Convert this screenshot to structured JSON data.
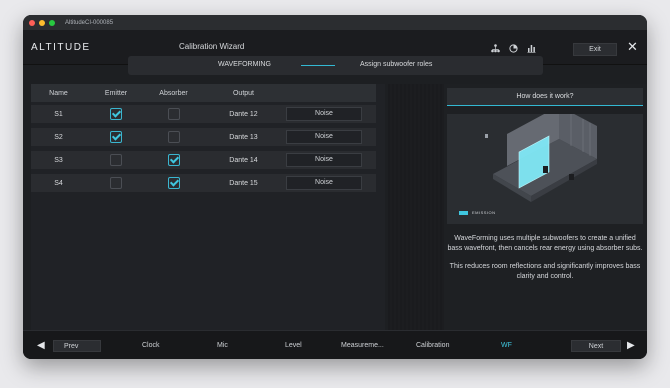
{
  "window": {
    "title": "AltitudeCI-000085",
    "traffic_colors": [
      "#fd5f57",
      "#febc2e",
      "#28c840"
    ]
  },
  "appbar": {
    "brand": "ALTITUDE",
    "title": "Calibration Wizard",
    "icons": [
      "network-icon",
      "pie-icon",
      "bar-chart-icon"
    ],
    "exit_label": "Exit",
    "close_icon": "close-icon"
  },
  "steps": {
    "left": "WAVEFORMING",
    "right": "Assign subwoofer roles",
    "accent": "#33b9d3"
  },
  "table": {
    "headers": [
      "Name",
      "Emitter",
      "Absorber",
      "Output"
    ],
    "rows": [
      {
        "name": "S1",
        "emitter": true,
        "absorber": false,
        "output": "Dante 12",
        "action": "Noise"
      },
      {
        "name": "S2",
        "emitter": true,
        "absorber": false,
        "output": "Dante 13",
        "action": "Noise"
      },
      {
        "name": "S3",
        "emitter": false,
        "absorber": true,
        "output": "Dante 14",
        "action": "Noise"
      },
      {
        "name": "S4",
        "emitter": false,
        "absorber": true,
        "output": "Dante 15",
        "action": "Noise"
      }
    ]
  },
  "info": {
    "header": "How does it work?",
    "legend": "EMISSION",
    "paragraph1": "WaveForming uses multiple subwoofers to create a unified bass wavefront, then cancels rear energy using absorber subs.",
    "paragraph2": "This reduces room reflections and significantly improves bass clarity and control."
  },
  "bottom_nav": {
    "prev": "Prev",
    "next": "Next",
    "items": [
      "Clock",
      "Mic",
      "Level",
      "Measureme...",
      "Calibration",
      "WF"
    ],
    "active": "WF"
  }
}
